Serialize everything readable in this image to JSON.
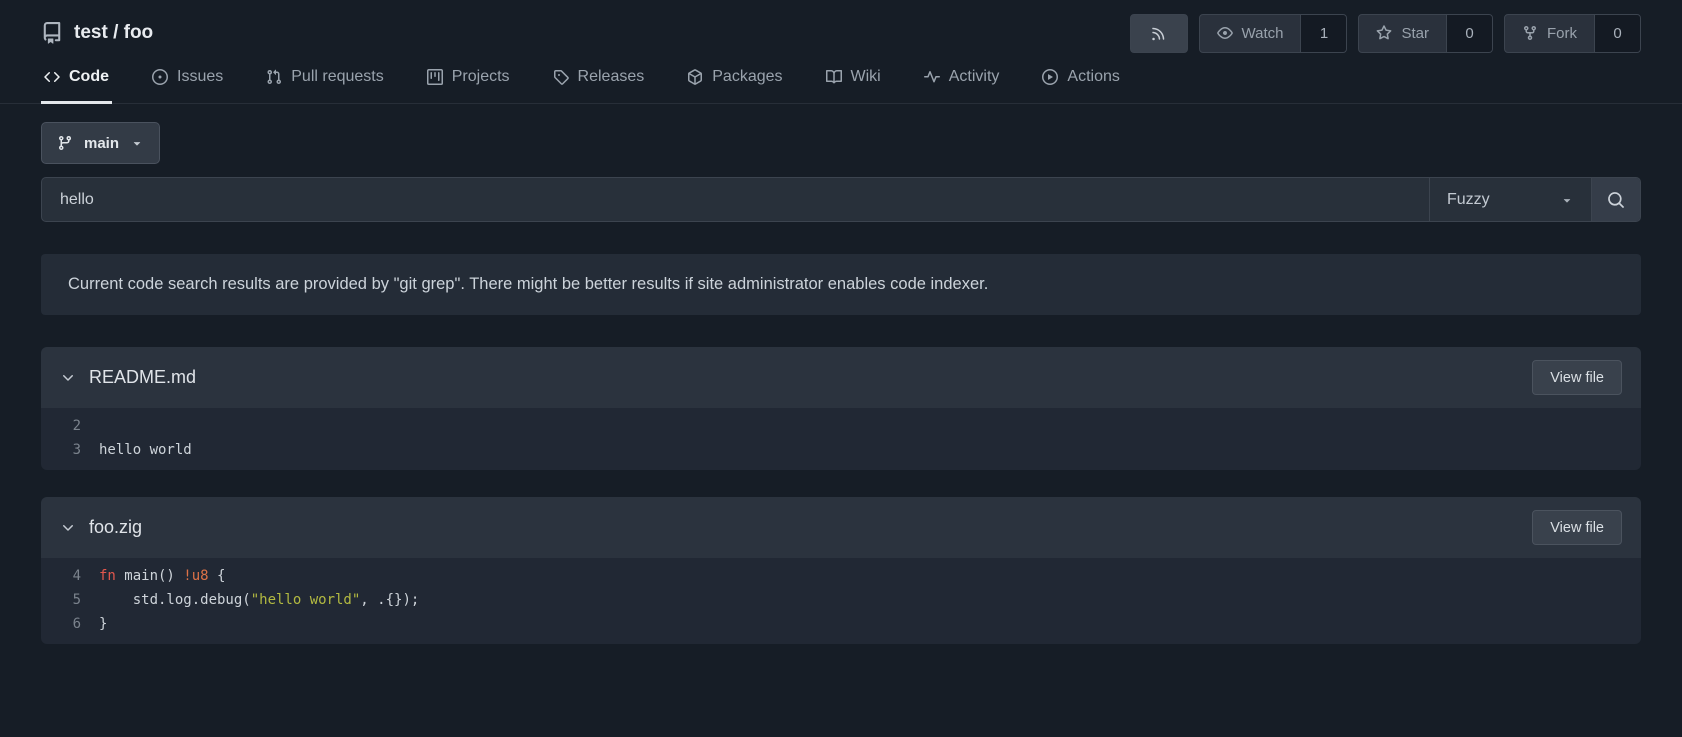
{
  "header": {
    "repo_title": "test / foo",
    "watch": {
      "label": "Watch",
      "count": "1"
    },
    "star": {
      "label": "Star",
      "count": "0"
    },
    "fork": {
      "label": "Fork",
      "count": "0"
    }
  },
  "nav": {
    "tabs": [
      {
        "label": "Code",
        "active": true
      },
      {
        "label": "Issues",
        "active": false
      },
      {
        "label": "Pull requests",
        "active": false
      },
      {
        "label": "Projects",
        "active": false
      },
      {
        "label": "Releases",
        "active": false
      },
      {
        "label": "Packages",
        "active": false
      },
      {
        "label": "Wiki",
        "active": false
      },
      {
        "label": "Activity",
        "active": false
      },
      {
        "label": "Actions",
        "active": false
      }
    ]
  },
  "branch_selector": {
    "label": "main"
  },
  "search": {
    "value": "hello",
    "mode": "Fuzzy"
  },
  "notice": {
    "text": "Current code search results are provided by \"git grep\". There might be better results if site administrator enables code indexer."
  },
  "results": [
    {
      "filename": "README.md",
      "view_file_label": "View file",
      "lines": [
        {
          "num": "2",
          "segments": []
        },
        {
          "num": "3",
          "segments": [
            {
              "text": "hello world"
            }
          ]
        }
      ]
    },
    {
      "filename": "foo.zig",
      "view_file_label": "View file",
      "lines": [
        {
          "num": "4",
          "segments": [
            {
              "text": "fn",
              "cls": "keyword"
            },
            {
              "text": " main() "
            },
            {
              "text": "!u8",
              "cls": "type"
            },
            {
              "text": " {"
            }
          ]
        },
        {
          "num": "5",
          "segments": [
            {
              "text": "    std.log.debug("
            },
            {
              "text": "\"hello world\"",
              "cls": "string"
            },
            {
              "text": ", .{});"
            }
          ]
        },
        {
          "num": "6",
          "segments": [
            {
              "text": "}"
            }
          ]
        }
      ]
    }
  ],
  "colors": {
    "page_background": "#161d26",
    "box_header_background": "#2b333e",
    "code_background": "#212834",
    "notice_background": "#242c37",
    "syntax": {
      "keyword": "#e2574d",
      "type": "#dd7247",
      "string": "#b3ba41"
    }
  }
}
